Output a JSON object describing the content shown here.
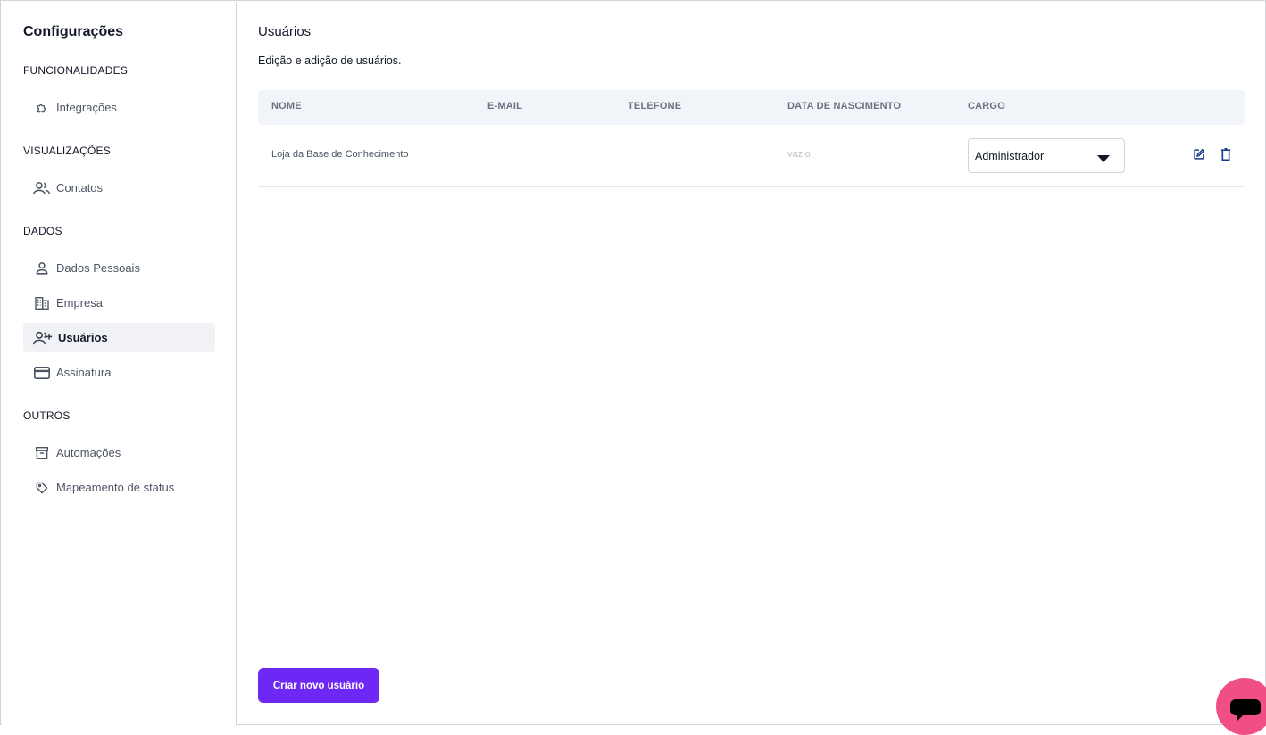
{
  "sidebar": {
    "title": "Configurações",
    "sections": [
      {
        "label": "FUNCIONALIDADES",
        "items": [
          {
            "label": "Integrações",
            "icon": "puzzle-icon",
            "active": false
          }
        ]
      },
      {
        "label": "VISUALIZAÇÕES",
        "items": [
          {
            "label": "Contatos",
            "icon": "people-icon",
            "active": false
          }
        ]
      },
      {
        "label": "DADOS",
        "items": [
          {
            "label": "Dados Pessoais",
            "icon": "person-icon",
            "active": false
          },
          {
            "label": "Empresa",
            "icon": "building-icon",
            "active": false
          },
          {
            "label": "Usuários",
            "icon": "add-user-icon",
            "active": true
          },
          {
            "label": "Assinatura",
            "icon": "credit-card-icon",
            "active": false
          }
        ]
      },
      {
        "label": "OUTROS",
        "items": [
          {
            "label": "Automações",
            "icon": "archive-icon",
            "active": false
          },
          {
            "label": "Mapeamento de status",
            "icon": "tag-icon",
            "active": false
          }
        ]
      }
    ]
  },
  "main": {
    "title": "Usuários",
    "subtitle": "Edição e adição de usuários.",
    "table": {
      "columns": [
        "NOME",
        "E-MAIL",
        "TELEFONE",
        "DATA DE NASCIMENTO",
        "CARGO"
      ],
      "rows": [
        {
          "name": "Loja da Base de Conhecimento",
          "email": "",
          "phone": "",
          "birthdate": "vazio",
          "role": "Administrador"
        }
      ]
    },
    "create_button_label": "Criar novo usuário"
  },
  "colors": {
    "accent": "#6d28f5",
    "chat_bubble": "#ef4f86",
    "header_bg": "#f1f4f9",
    "active_nav_bg": "#f0f2f5",
    "action_icon": "#1e3a8a"
  }
}
